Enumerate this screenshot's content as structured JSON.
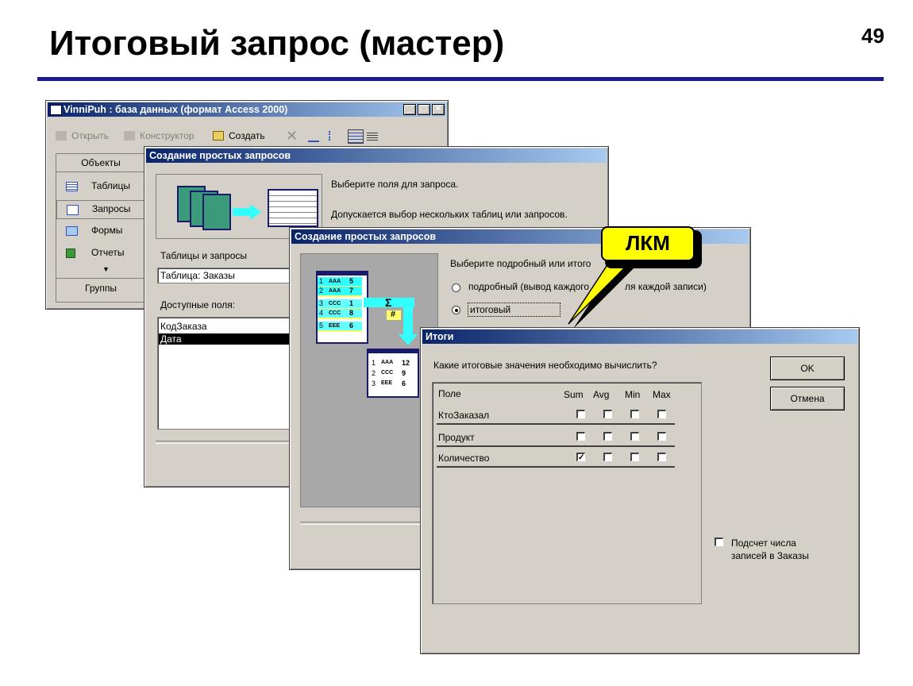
{
  "slide": {
    "title": "Итоговый запрос (мастер)",
    "page_number": "49"
  },
  "db_window": {
    "title": "VinniPuh : база данных (формат Access 2000)",
    "toolbar": {
      "open": "Открыть",
      "design": "Конструктор",
      "create": "Создать"
    },
    "objects_header": "Объекты",
    "items": [
      {
        "label": "Таблицы",
        "icon": "table-icon"
      },
      {
        "label": "Запросы",
        "icon": "query-icon"
      },
      {
        "label": "Формы",
        "icon": "form-icon"
      },
      {
        "label": "Отчеты",
        "icon": "report-icon"
      }
    ],
    "groups_label": "Группы",
    "window_buttons": {
      "minimize": "_",
      "maximize": "□",
      "close": "×"
    }
  },
  "wizard1": {
    "title": "Создание простых запросов",
    "text1": "Выберите поля для запроса.",
    "text2": "Допускается выбор нескольких таблиц или запросов.",
    "tables_label": "Таблицы и запросы",
    "tables_value": "Таблица: Заказы",
    "fields_label": "Доступные поля:",
    "fields": [
      "КодЗаказа",
      "Дата"
    ]
  },
  "wizard2": {
    "title": "Создание простых запросов",
    "prompt": "Выберите подробный или итого",
    "options": [
      {
        "label": "подробный (вывод каждого",
        "suffix": "ля каждой записи)",
        "selected": false
      },
      {
        "label": "итоговый",
        "selected": true
      }
    ],
    "diagram": {
      "source_rows": [
        {
          "n": "1",
          "code": "AAA",
          "v": "5"
        },
        {
          "n": "2",
          "code": "AAA",
          "v": "7"
        },
        {
          "n": "3",
          "code": "CCC",
          "v": "1"
        },
        {
          "n": "4",
          "code": "CCC",
          "v": "8"
        },
        {
          "n": "5",
          "code": "EEE",
          "v": "6"
        }
      ],
      "sigma": "Σ",
      "hash": "#",
      "result_rows": [
        {
          "n": "1",
          "code": "AAA",
          "v": "12"
        },
        {
          "n": "2",
          "code": "CCC",
          "v": "9"
        },
        {
          "n": "3",
          "code": "EEE",
          "v": "6"
        }
      ]
    }
  },
  "callout": {
    "label": "ЛКМ"
  },
  "totals_dialog": {
    "title": "Итоги",
    "question": "Какие итоговые значения необходимо вычислить?",
    "columns": [
      "Поле",
      "Sum",
      "Avg",
      "Min",
      "Max"
    ],
    "rows": [
      {
        "field": "КтоЗаказал",
        "checks": [
          false,
          false,
          false,
          false
        ]
      },
      {
        "field": "Продукт",
        "checks": [
          false,
          false,
          false,
          false
        ]
      },
      {
        "field": "Количество",
        "checks": [
          true,
          false,
          false,
          false
        ]
      }
    ],
    "ok": "OK",
    "cancel": "Отмена",
    "count_line1": "Подсчет числа",
    "count_line2": "записей в Заказы",
    "count_checked": false
  },
  "colors": {
    "title_rule": "#1a1a8c",
    "dialog_bg": "#d4d0c8",
    "titlebar_start": "#0a246a",
    "titlebar_end": "#a6caf0",
    "callout": "#ffff00",
    "diagram_arrow": "#33ffff"
  }
}
